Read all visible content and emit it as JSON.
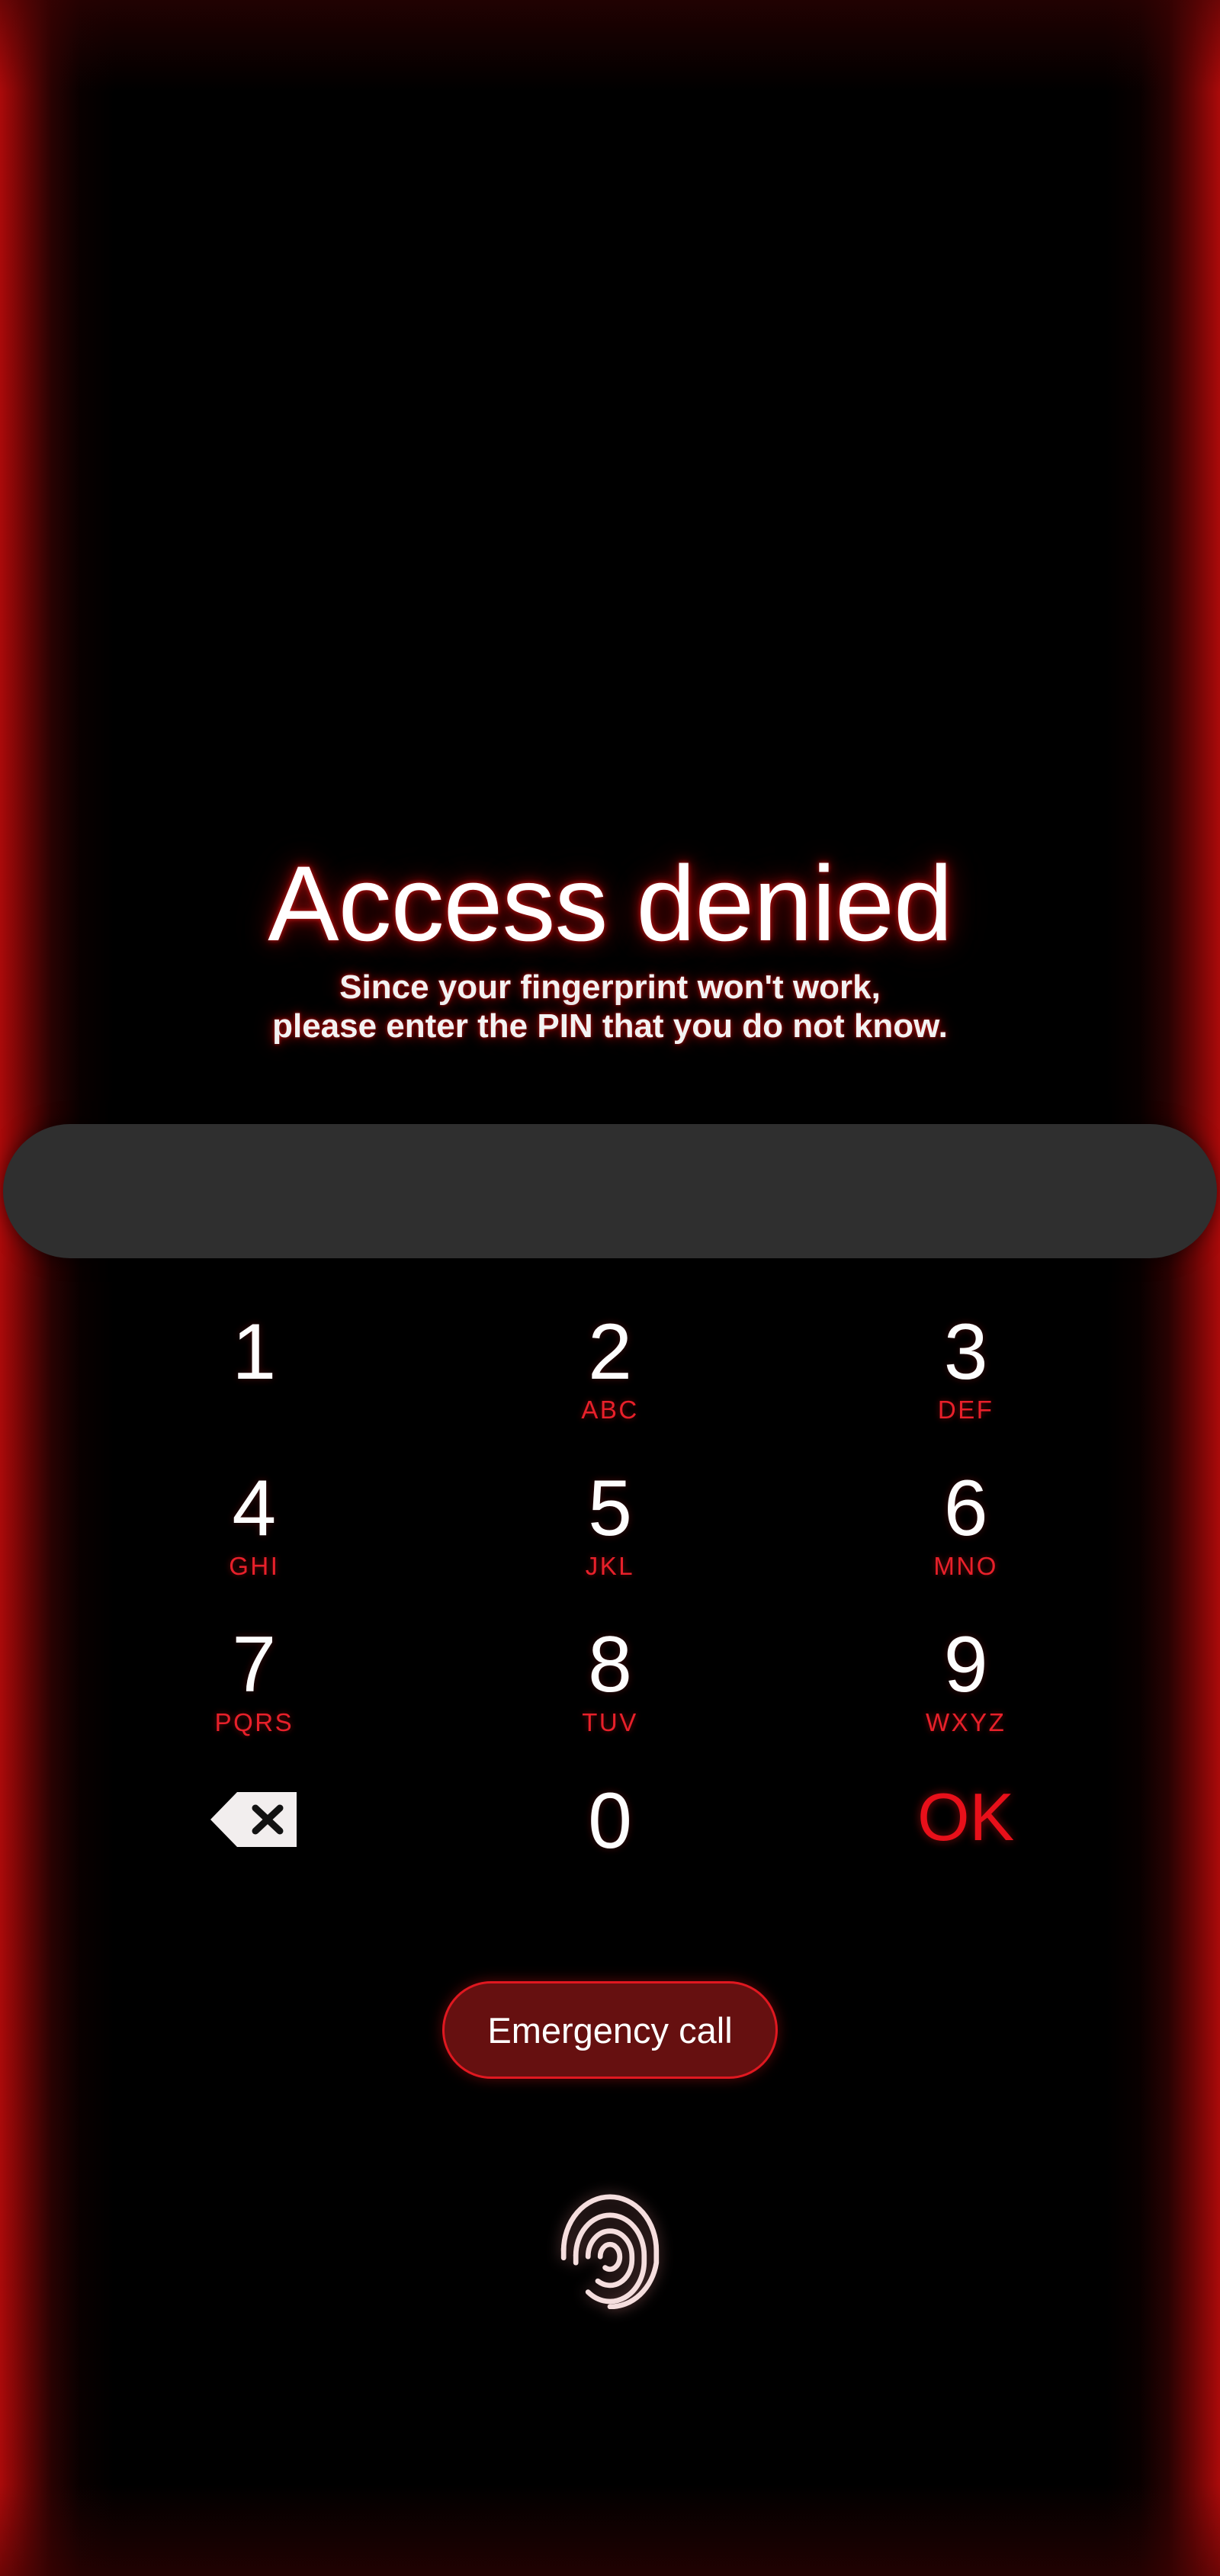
{
  "screen": {
    "background_color": "#000000",
    "edge_glow_color": "#aa0a0a"
  },
  "header": {
    "title": "Access denied",
    "title_color": "#ffffff",
    "glow_color": "#c81414",
    "subtitle_line_1": "Since your fingerprint won't work,",
    "subtitle_line_2": "please enter the PIN that you do not know."
  },
  "pin_field": {
    "value": "",
    "placeholder": "",
    "background_color": "#2f2f2f"
  },
  "keypad": {
    "keys": [
      {
        "digit": "1",
        "letters": "",
        "name": "key-1"
      },
      {
        "digit": "2",
        "letters": "ABC",
        "name": "key-2"
      },
      {
        "digit": "3",
        "letters": "DEF",
        "name": "key-3"
      },
      {
        "digit": "4",
        "letters": "GHI",
        "name": "key-4"
      },
      {
        "digit": "5",
        "letters": "JKL",
        "name": "key-5"
      },
      {
        "digit": "6",
        "letters": "MNO",
        "name": "key-6"
      },
      {
        "digit": "7",
        "letters": "PQRS",
        "name": "key-7"
      },
      {
        "digit": "8",
        "letters": "TUV",
        "name": "key-8"
      },
      {
        "digit": "9",
        "letters": "WXYZ",
        "name": "key-9"
      }
    ],
    "backspace_icon": "backspace-icon",
    "zero_digit": "0",
    "ok_label": "OK",
    "digit_color": "#fdfdfd",
    "letters_color": "#e8202a",
    "ok_color": "#e8101a"
  },
  "emergency": {
    "label": "Emergency call",
    "fill_color": "#661010",
    "border_color": "#e01820",
    "text_color": "#ffffff"
  },
  "fingerprint": {
    "icon": "fingerprint-icon",
    "color": "#f2d6d6"
  }
}
